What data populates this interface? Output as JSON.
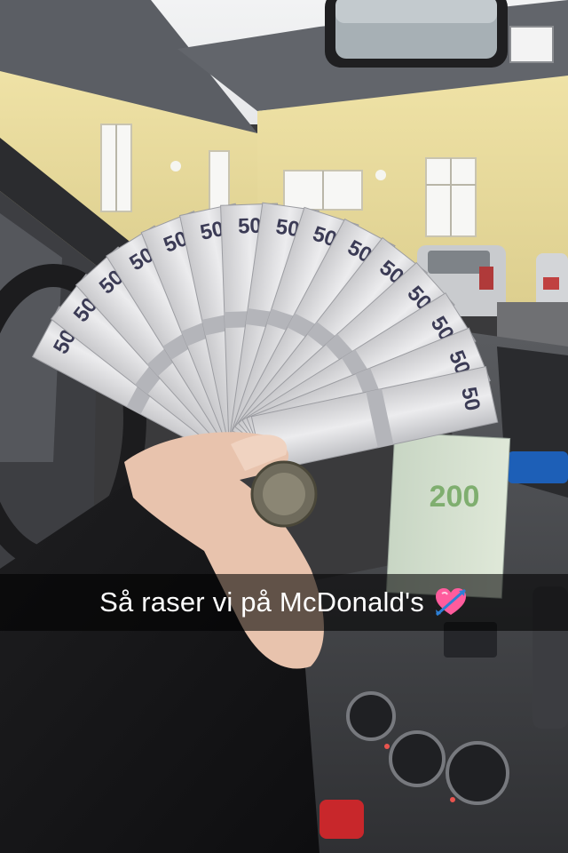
{
  "snap": {
    "caption": "Så raser vi på McDonald's",
    "caption_emoji": "heart-with-arrow-icon",
    "banknote_label": "50",
    "banknote_label_large": "200"
  },
  "colors": {
    "caption_bar": "#000000",
    "caption_text": "#ffffff",
    "building_wall": "#e6d79a",
    "roof": "#5d6066",
    "dashboard": "#4a4a4d",
    "heart": "#ff5c9d"
  }
}
